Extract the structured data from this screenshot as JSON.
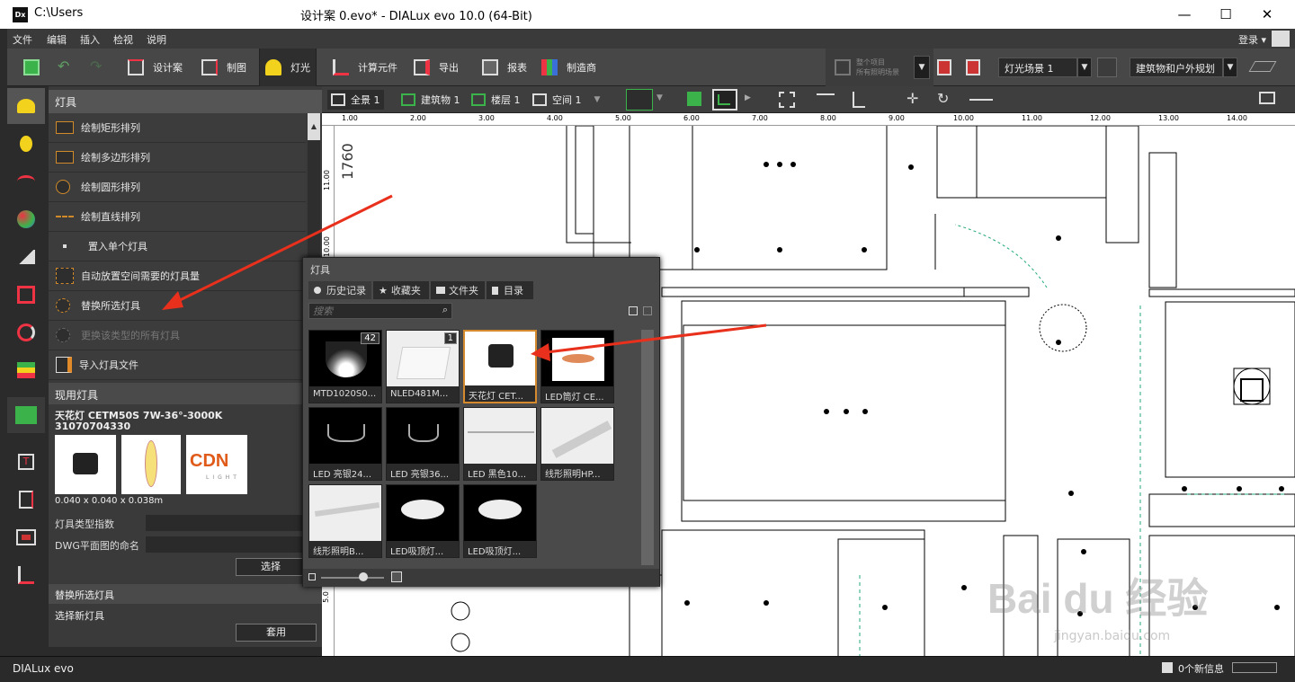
{
  "window": {
    "path": "C:\\Users",
    "title": "设计案 0.evo* - DIALux evo 10.0  (64-Bit)",
    "minimize": "—",
    "maximize": "☐",
    "close": "✕"
  },
  "menu": [
    "文件",
    "编辑",
    "插入",
    "检视",
    "说明"
  ],
  "login": "登录 ▾",
  "ribbon": {
    "tabs": [
      "设计案",
      "制图",
      "灯光",
      "计算元件",
      "导出",
      "报表",
      "制造商"
    ],
    "active": "灯光",
    "calc_button": "整个项目\n所有照明场景",
    "light_scene": "灯光场景 1",
    "mode": "建筑物和户外规划"
  },
  "viewbar": {
    "tabs": [
      "全景 1",
      "建筑物 1",
      "楼层 1",
      "空间 1"
    ]
  },
  "ruler": {
    "labels": [
      "1.00",
      "2.00",
      "3.00",
      "4.00",
      "5.00",
      "6.00",
      "7.00",
      "8.00",
      "9.00",
      "10.00",
      "11.00",
      "12.00",
      "13.00",
      "14.00"
    ],
    "vlabels": [
      "11.00",
      "10.00",
      "5.0"
    ]
  },
  "panel": {
    "header": "灯具",
    "items": [
      {
        "label": "绘制矩形排列",
        "disabled": false
      },
      {
        "label": "绘制多边形排列",
        "disabled": false
      },
      {
        "label": "绘制圆形排列",
        "disabled": false
      },
      {
        "label": "绘制直线排列",
        "disabled": false
      },
      {
        "label": "置入单个灯具",
        "disabled": false
      },
      {
        "label": "自动放置空间需要的灯具量",
        "disabled": false
      },
      {
        "label": "替换所选灯具",
        "disabled": false
      },
      {
        "label": "更换该类型的所有灯具",
        "disabled": true
      },
      {
        "label": "导入灯具文件",
        "disabled": false
      }
    ],
    "current_header": "现用灯具",
    "current_name": "天花灯 CETM50S 7W-36°-3000K",
    "current_code": "31070704330",
    "brand": "CDN",
    "brand_sub": "LIGHT",
    "dimensions": "0.040 x 0.040 x 0.038m",
    "type_index_label": "灯具类型指数",
    "dwg_label": "DWG平面图的命名",
    "select_button": "选择",
    "replace_header": "替换所选灯具",
    "select_new": "选择新灯具",
    "apply_button": "套用"
  },
  "popup": {
    "title": "灯具",
    "tabs": [
      "历史记录",
      "收藏夹",
      "文件夹",
      "目录"
    ],
    "search_placeholder": "搜索",
    "items": [
      {
        "label": "MTD1020S0...",
        "badge": "42",
        "style": "dark"
      },
      {
        "label": "NLED481M...",
        "badge": "1",
        "style": "light"
      },
      {
        "label": "天花灯 CET...",
        "badge": "",
        "style": "selected"
      },
      {
        "label": "LED筒灯 CE...",
        "badge": "",
        "style": "dark"
      },
      {
        "label": "LED  亮银24...",
        "badge": "",
        "style": "dark"
      },
      {
        "label": "LED  亮银36...",
        "badge": "",
        "style": "dark"
      },
      {
        "label": "LED  黑色10...",
        "badge": "",
        "style": "light"
      },
      {
        "label": "线形照明HP...",
        "badge": "",
        "style": "light"
      },
      {
        "label": "线形照明B...",
        "badge": "",
        "style": "light"
      },
      {
        "label": "LED吸顶灯...",
        "badge": "",
        "style": "dark"
      },
      {
        "label": "LED吸顶灯...",
        "badge": "",
        "style": "dark"
      }
    ]
  },
  "status": {
    "app": "DIALux evo",
    "messages": "0个新信息"
  },
  "watermark": {
    "brand": "Bai  du 经验",
    "url": "jingyan.baidu.com"
  },
  "drawing": {
    "dim_text": "1760"
  },
  "colors": {
    "accent": "#d68a2e",
    "arrow": "#e8301c",
    "green": "#3cb34a"
  }
}
